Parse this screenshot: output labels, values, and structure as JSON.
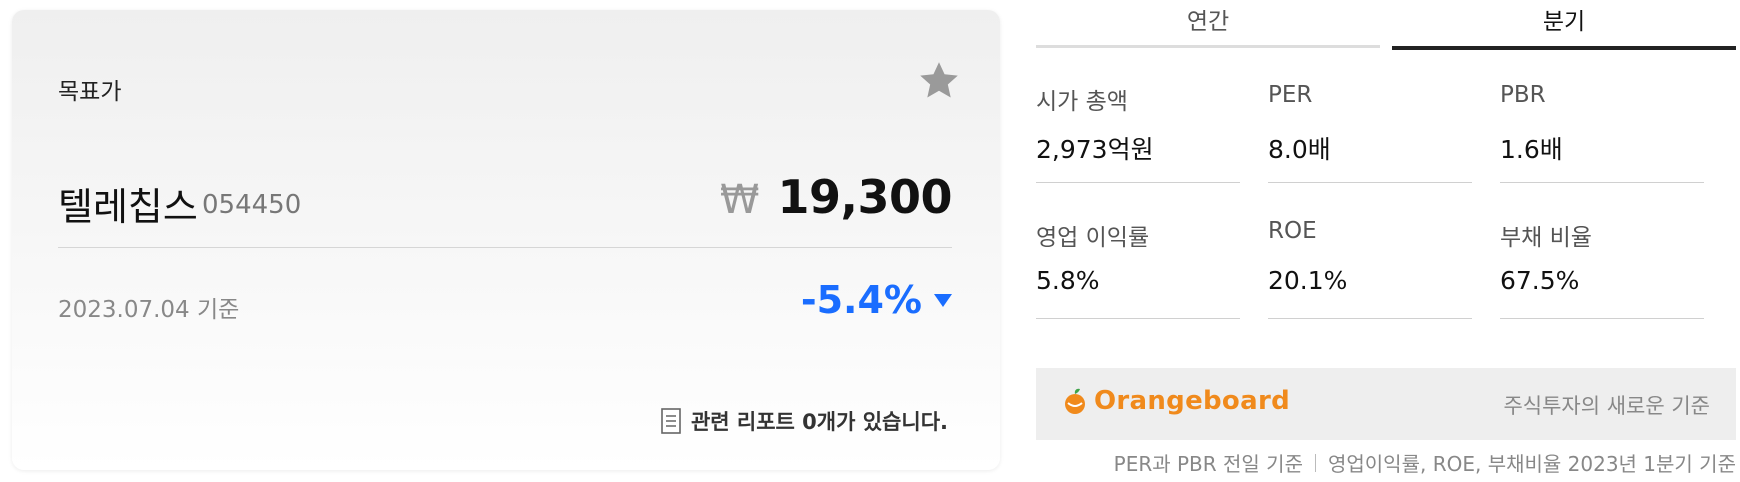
{
  "target_price_card": {
    "title": "목표가",
    "stock_name": "텔레칩스",
    "stock_code": "054450",
    "currency_symbol": "₩",
    "price": "19,300",
    "date_basis": "2023.07.04 기준",
    "change": "-5.4%",
    "change_color": "#1a6dff",
    "report_text": "관련 리포트 0개가 있습니다."
  },
  "tabs": {
    "annual": "연간",
    "quarter": "분기",
    "selected": "quarter"
  },
  "metrics": [
    {
      "label": "시가 총액",
      "value": "2,973억원"
    },
    {
      "label": "PER",
      "value": "8.0배"
    },
    {
      "label": "PBR",
      "value": "1.6배"
    },
    {
      "label": "영업 이익률",
      "value": "5.8%"
    },
    {
      "label": "ROE",
      "value": "20.1%"
    },
    {
      "label": "부채 비율",
      "value": "67.5%"
    }
  ],
  "banner": {
    "brand": "Orangeboard",
    "slogan": "주식투자의 새로운 기준",
    "brand_color": "#f08a1c"
  },
  "footnote": {
    "part1": "PER과 PBR 전일 기준",
    "part2": "영업이익률, ROE, 부채비율 2023년 1분기 기준"
  }
}
